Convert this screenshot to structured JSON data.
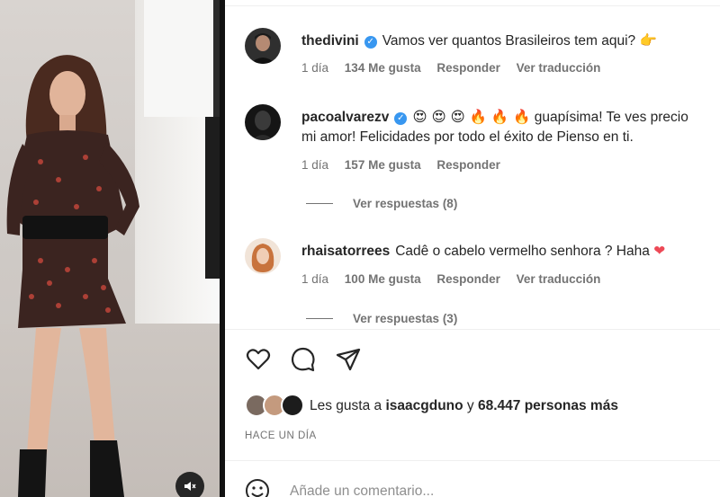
{
  "comments": [
    {
      "username": "thedivini",
      "verified": true,
      "text": "Vamos ver quantos Brasileiros tem aqui?",
      "emoji": "👉",
      "time": "1 día",
      "likes": "134 Me gusta",
      "reply": "Responder",
      "translate": "Ver traducción"
    },
    {
      "username": "pacoalvarezv",
      "verified": true,
      "emoji": "😍 😍 😍 🔥 🔥 🔥",
      "text": "guapísima! Te ves precio",
      "text_line2": "mi amor! Felicidades por todo el éxito de Pienso en ti.",
      "time": "1 día",
      "likes": "157 Me gusta",
      "reply": "Responder",
      "view_replies": "Ver respuestas (8)"
    },
    {
      "username": "rhaisatorrees",
      "verified": false,
      "text": "Cadê o cabelo vermelho senhora ? Haha",
      "emoji": "❤",
      "time": "1 día",
      "likes": "100 Me gusta",
      "reply": "Responder",
      "translate": "Ver traducción",
      "view_replies": "Ver respuestas (3)"
    }
  ],
  "actions": {
    "like_icon": "heart-icon",
    "comment_icon": "comment-icon",
    "share_icon": "share-icon"
  },
  "likes_summary": {
    "prefix": "Les gusta a",
    "user": "isaacgduno",
    "connector": "y",
    "count": "68.447 personas más"
  },
  "timestamp": "HACE UN DÍA",
  "add_comment": {
    "placeholder": "Añade un comentario..."
  },
  "colors": {
    "verified": "#3897f0",
    "secondary_text": "#737373",
    "heart": "#ed4956"
  }
}
